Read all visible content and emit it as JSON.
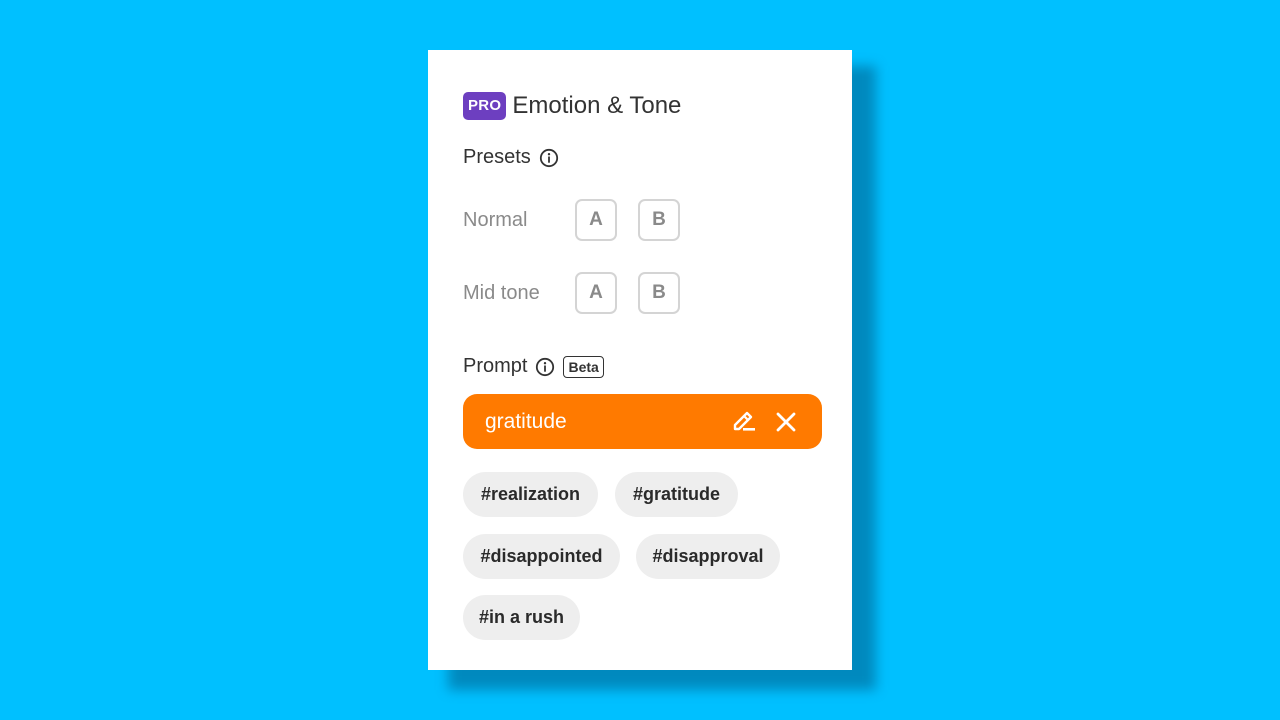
{
  "header": {
    "badge": "PRO",
    "title": "Emotion & Tone"
  },
  "presets": {
    "label": "Presets",
    "rows": [
      {
        "label": "Normal",
        "options": [
          "A",
          "B"
        ]
      },
      {
        "label": "Mid tone",
        "options": [
          "A",
          "B"
        ]
      }
    ]
  },
  "prompt": {
    "label": "Prompt",
    "badge": "Beta",
    "value": "gratitude"
  },
  "tags": [
    "#realization",
    "#gratitude",
    "#disappointed",
    "#disapproval",
    "#in a rush"
  ],
  "colors": {
    "background": "#00c0ff",
    "pro_badge": "#6d3fc0",
    "prompt_pill": "#ff7a00",
    "tag_bg": "#eeeeee"
  },
  "icons": {
    "presets_info": "info-icon",
    "prompt_info": "info-icon",
    "edit": "pencil-icon",
    "clear": "close-icon"
  }
}
